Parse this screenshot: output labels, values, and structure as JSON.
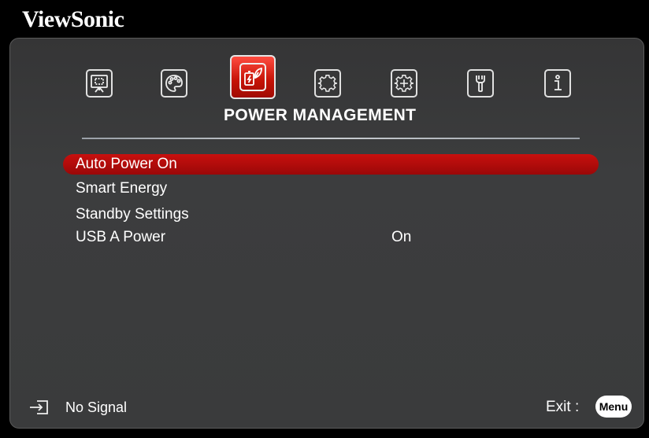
{
  "brand": "ViewSonic",
  "tabs": [
    {
      "icon": "display-icon"
    },
    {
      "icon": "palette-icon"
    },
    {
      "icon": "power-management-icon",
      "selected": true
    },
    {
      "icon": "basic-gear-icon"
    },
    {
      "icon": "advanced-gear-icon"
    },
    {
      "icon": "tools-icon"
    },
    {
      "icon": "info-icon"
    }
  ],
  "menu": {
    "title": "POWER MANAGEMENT",
    "items": [
      {
        "label": "Auto Power On",
        "value": ""
      },
      {
        "label": "Smart Energy",
        "value": ""
      },
      {
        "label": "Standby Settings",
        "value": ""
      },
      {
        "label": "USB A Power",
        "value": "On"
      }
    ]
  },
  "footer": {
    "signal": "No Signal",
    "exit_label": "Exit :",
    "menu_button": "Menu"
  },
  "colors": {
    "highlight": "#b00d0b",
    "panel": "#3a3b3c",
    "background": "#000000"
  }
}
